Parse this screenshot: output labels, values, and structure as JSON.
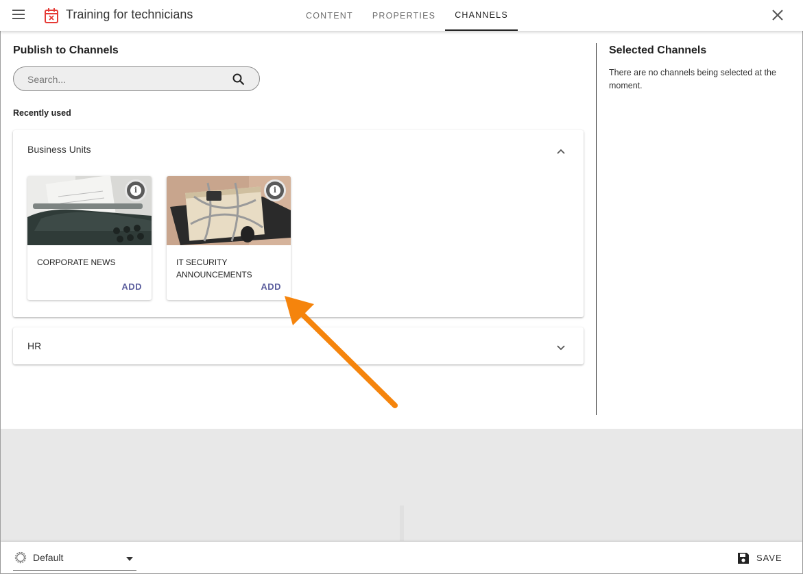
{
  "header": {
    "title": "Training for technicians",
    "tabs": [
      {
        "label": "CONTENT",
        "active": false
      },
      {
        "label": "PROPERTIES",
        "active": false
      },
      {
        "label": "CHANNELS",
        "active": true
      }
    ],
    "icons": {
      "menu": "menu-icon",
      "app": "calendar-remove-icon",
      "close": "close-icon"
    }
  },
  "publish": {
    "title": "Publish to Channels",
    "search_placeholder": "Search...",
    "recent_label": "Recently used",
    "groups": [
      {
        "title": "Business Units",
        "expanded": true,
        "channels": [
          {
            "title": "CORPORATE NEWS",
            "action": "ADD"
          },
          {
            "title": "IT SECURITY ANNOUNCEMENTS",
            "action": "ADD"
          }
        ]
      },
      {
        "title": "HR",
        "expanded": false,
        "channels": []
      }
    ]
  },
  "selected": {
    "title": "Selected Channels",
    "empty_text": "There are no channels being selected at the moment."
  },
  "footer": {
    "default_label": "Default",
    "save_label": "SAVE"
  },
  "colors": {
    "accent": "#5c5f9e",
    "annotation_arrow": "#f5840c",
    "app_icon": "#e53935"
  }
}
